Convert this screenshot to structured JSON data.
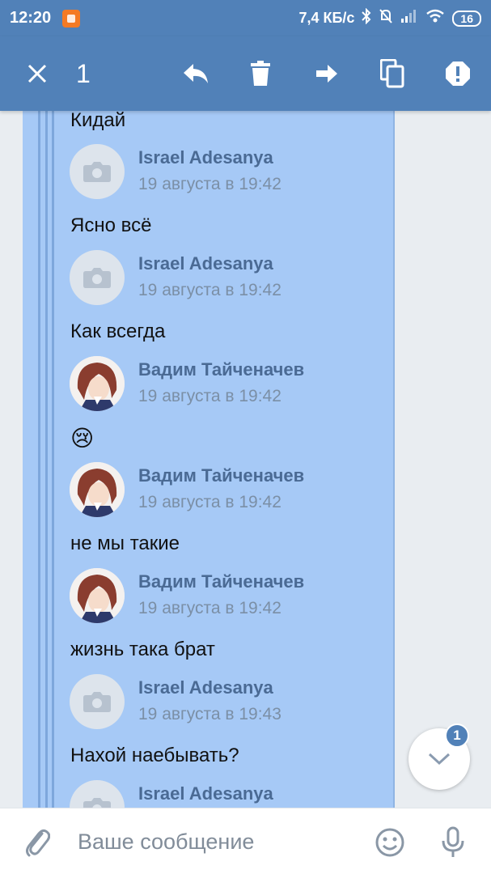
{
  "status_bar": {
    "time": "12:20",
    "network_speed": "7,4 КБ/с",
    "battery": "16"
  },
  "toolbar": {
    "selected_count": "1",
    "icons": [
      "close-icon",
      "reply-icon",
      "delete-icon",
      "forward-icon",
      "copy-icon",
      "report-icon"
    ]
  },
  "messages": [
    {
      "text": "Кидай"
    },
    {
      "author": "Israel Adesanya",
      "date": "19 августа в 19:42",
      "avatar": "camera-placeholder",
      "text": "Ясно всё"
    },
    {
      "author": "Israel Adesanya",
      "date": "19 августа в 19:42",
      "avatar": "camera-placeholder",
      "text": "Как всегда"
    },
    {
      "author": "Вадим Тайченачев",
      "date": "19 августа в 19:42",
      "avatar": "anime-avatar",
      "text": "😢"
    },
    {
      "author": "Вадим Тайченачев",
      "date": "19 августа в 19:42",
      "avatar": "anime-avatar",
      "text": "не мы такие"
    },
    {
      "author": "Вадим Тайченачев",
      "date": "19 августа в 19:42",
      "avatar": "anime-avatar",
      "text": "жизнь така брат"
    },
    {
      "author": "Israel Adesanya",
      "date": "19 августа в 19:43",
      "avatar": "camera-placeholder",
      "text": "Нахой наебывать?"
    },
    {
      "author": "Israel Adesanya",
      "avatar": "camera-placeholder"
    }
  ],
  "scroll_down": {
    "badge": "1"
  },
  "composer": {
    "placeholder": "Ваше сообщение"
  },
  "colors": {
    "header": "#5181b8",
    "selection": "#a6c9f6",
    "author": "#4a6a94",
    "date": "#7b8fa6"
  }
}
